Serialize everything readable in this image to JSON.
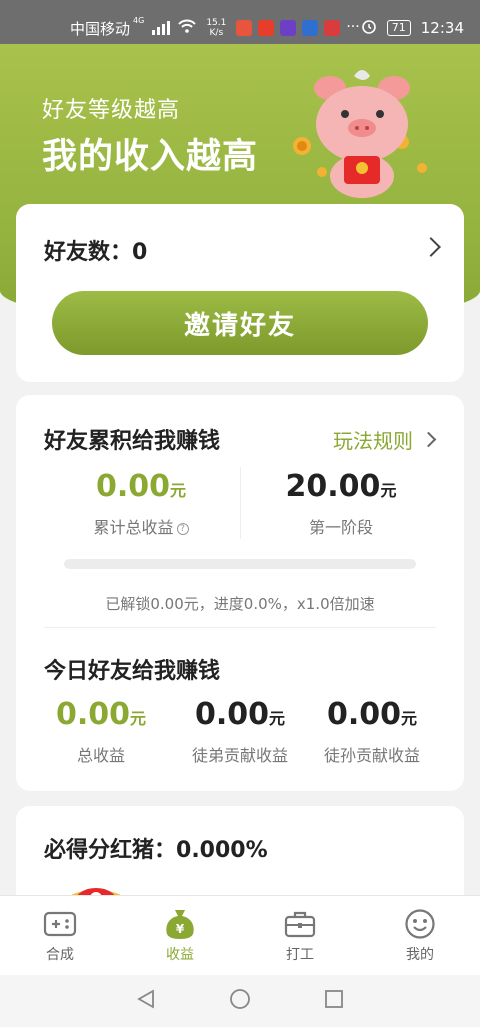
{
  "status_bar": {
    "carrier": "中国移动",
    "network_type": "4G",
    "speed_value": "15.1",
    "speed_unit": "K/s",
    "battery": "71",
    "time": "12:34"
  },
  "hero": {
    "subtitle": "好友等级越高",
    "title": "我的收入越高"
  },
  "friends": {
    "label": "好友数：",
    "count": "0",
    "invite_label": "邀请好友"
  },
  "accumulate": {
    "title": "好友累积给我赚钱",
    "rules_label": "玩法规则",
    "total_value": "0.00",
    "total_unit": "元",
    "total_label": "累计总收益",
    "stage_value": "20.00",
    "stage_unit": "元",
    "stage_label": "第一阶段",
    "progress_fraction": 0.0,
    "progress_text": "已解锁0.00元，进度0.0%，x1.0倍加速"
  },
  "today": {
    "title": "今日好友给我赚钱",
    "stats": [
      {
        "value": "0.00",
        "unit": "元",
        "label": "总收益"
      },
      {
        "value": "0.00",
        "unit": "元",
        "label": "徒弟贡献收益"
      },
      {
        "value": "0.00",
        "unit": "元",
        "label": "徒孙贡献收益"
      }
    ]
  },
  "dividend": {
    "label": "必得分红猪：",
    "value": "0.000%"
  },
  "tabs": [
    {
      "label": "合成",
      "icon": "gamepad-icon"
    },
    {
      "label": "收益",
      "icon": "money-bag-icon"
    },
    {
      "label": "打工",
      "icon": "briefcase-icon"
    },
    {
      "label": "我的",
      "icon": "smiley-icon"
    }
  ],
  "colors": {
    "accent": "#8aa832",
    "hero": "#9bb845",
    "button": "#8aa832"
  }
}
